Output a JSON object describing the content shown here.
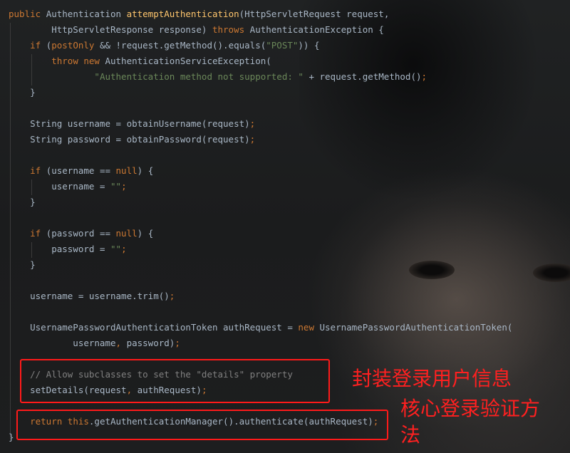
{
  "code_lines": [
    {
      "parts": [
        [
          "kw",
          "public "
        ],
        [
          "",
          "Authentication "
        ],
        [
          "fn",
          "attemptAuthentication"
        ],
        [
          "",
          "(HttpServletRequest request,"
        ]
      ]
    },
    {
      "parts": [
        [
          "",
          "        HttpServletResponse response) "
        ],
        [
          "kw",
          "throws "
        ],
        [
          "",
          "AuthenticationException {"
        ]
      ]
    },
    {
      "parts": [
        [
          "",
          "    "
        ],
        [
          "kw",
          "if "
        ],
        [
          "",
          "("
        ],
        [
          "kw",
          "postOnly "
        ],
        [
          "",
          "&& !request.getMethod().equals("
        ],
        [
          "str",
          "\"POST\""
        ],
        [
          "",
          ")) {"
        ]
      ]
    },
    {
      "parts": [
        [
          "",
          "        "
        ],
        [
          "kw",
          "throw new "
        ],
        [
          "",
          "AuthenticationServiceException("
        ]
      ]
    },
    {
      "parts": [
        [
          "",
          "                "
        ],
        [
          "str",
          "\"Authentication method not supported: \" "
        ],
        [
          "",
          "+ request.getMethod()"
        ],
        [
          "kw",
          ";"
        ]
      ]
    },
    {
      "parts": [
        [
          "",
          "    }"
        ]
      ]
    },
    {
      "parts": [
        [
          "",
          ""
        ]
      ]
    },
    {
      "parts": [
        [
          "",
          "    String username = obtainUsername(request)"
        ],
        [
          "kw",
          ";"
        ]
      ]
    },
    {
      "parts": [
        [
          "",
          "    String password = obtainPassword(request)"
        ],
        [
          "kw",
          ";"
        ]
      ]
    },
    {
      "parts": [
        [
          "",
          ""
        ]
      ]
    },
    {
      "parts": [
        [
          "",
          "    "
        ],
        [
          "kw",
          "if "
        ],
        [
          "",
          "(username == "
        ],
        [
          "kw",
          "null"
        ],
        [
          "",
          ") {"
        ]
      ]
    },
    {
      "parts": [
        [
          "",
          "        username = "
        ],
        [
          "str",
          "\"\""
        ],
        [
          "kw",
          ";"
        ]
      ]
    },
    {
      "parts": [
        [
          "",
          "    }"
        ]
      ]
    },
    {
      "parts": [
        [
          "",
          ""
        ]
      ]
    },
    {
      "parts": [
        [
          "",
          "    "
        ],
        [
          "kw",
          "if "
        ],
        [
          "",
          "(password == "
        ],
        [
          "kw",
          "null"
        ],
        [
          "",
          ") {"
        ]
      ]
    },
    {
      "parts": [
        [
          "",
          "        password = "
        ],
        [
          "str",
          "\"\""
        ],
        [
          "kw",
          ";"
        ]
      ]
    },
    {
      "parts": [
        [
          "",
          "    }"
        ]
      ]
    },
    {
      "parts": [
        [
          "",
          ""
        ]
      ]
    },
    {
      "parts": [
        [
          "",
          "    username = username.trim()"
        ],
        [
          "kw",
          ";"
        ]
      ]
    },
    {
      "parts": [
        [
          "",
          ""
        ]
      ]
    },
    {
      "parts": [
        [
          "",
          "    UsernamePasswordAuthenticationToken authRequest = "
        ],
        [
          "kw",
          "new "
        ],
        [
          "",
          "UsernamePasswordAuthenticationToken("
        ]
      ]
    },
    {
      "parts": [
        [
          "",
          "            username"
        ],
        [
          "kw",
          ", "
        ],
        [
          "",
          "password)"
        ],
        [
          "kw",
          ";"
        ]
      ]
    },
    {
      "parts": [
        [
          "",
          ""
        ]
      ]
    },
    {
      "parts": [
        [
          "",
          "    "
        ],
        [
          "cmt",
          "// Allow subclasses to set the \"details\" property"
        ]
      ]
    },
    {
      "parts": [
        [
          "",
          "    setDetails(request"
        ],
        [
          "kw",
          ", "
        ],
        [
          "",
          "authRequest)"
        ],
        [
          "kw",
          ";"
        ]
      ]
    },
    {
      "parts": [
        [
          "",
          ""
        ]
      ]
    },
    {
      "parts": [
        [
          "",
          "    "
        ],
        [
          "kw",
          "return this"
        ],
        [
          "",
          ".getAuthenticationManager().authenticate(authRequest)"
        ],
        [
          "kw",
          ";"
        ]
      ]
    },
    {
      "parts": [
        [
          "",
          "}"
        ]
      ]
    }
  ],
  "annotations": {
    "box1_label": "封装登录用户信息",
    "box2_label_line1": "核心登录验证方",
    "box2_label_line2": "法"
  },
  "colors": {
    "keyword": "#cc7832",
    "string": "#6a8759",
    "method_decl": "#ffc66d",
    "comment": "#808080",
    "default": "#a9b7c6",
    "annotation_red": "#ff1a1a"
  }
}
